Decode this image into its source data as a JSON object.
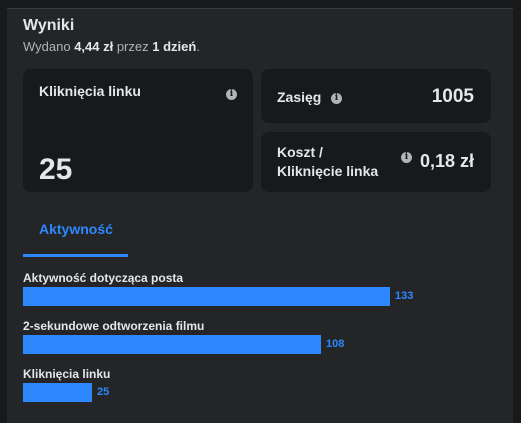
{
  "results": {
    "title": "Wyniki",
    "subtitle_prefix": "Wydano ",
    "amount": "4,44 zł",
    "subtitle_mid": " przez ",
    "duration": "1 dzień",
    "subtitle_suffix": "."
  },
  "cards": {
    "link_clicks": {
      "label": "Kliknięcia linku",
      "value": "25",
      "info_icon": "info-icon"
    },
    "reach": {
      "label": "Zasięg",
      "value": "1005",
      "info_icon": "info-icon"
    },
    "cost_per_click": {
      "label_line1": "Koszt /",
      "label_line2": "Kliknięcie linka",
      "value": "0,18 zł",
      "info_icon": "info-icon"
    }
  },
  "tabs": [
    {
      "label": "Aktywność",
      "active": true
    }
  ],
  "activity": {
    "max_value": 133,
    "items": [
      {
        "label": "Aktywność dotycząca posta",
        "value": 133
      },
      {
        "label": "2-sekundowe odtworzenia filmu",
        "value": 108
      },
      {
        "label": "Kliknięcia linku",
        "value": 25
      }
    ]
  },
  "colors": {
    "accent": "#2d88ff",
    "card_bg": "#18191a",
    "panel_bg": "#242526"
  }
}
